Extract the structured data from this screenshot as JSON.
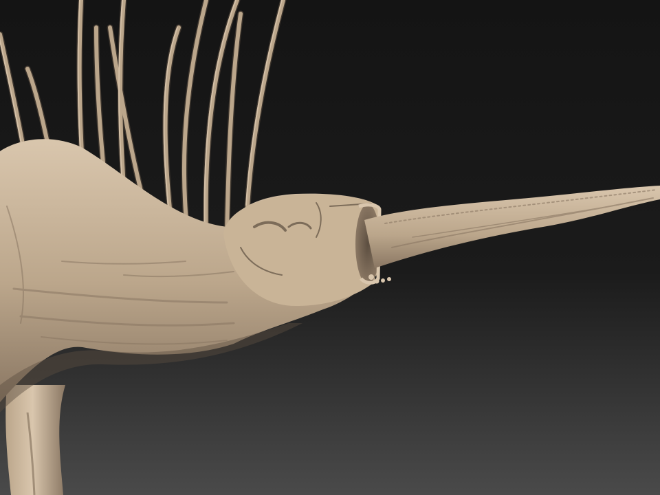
{
  "scene": {
    "subject": "sculpted-creature-render",
    "colors": {
      "background_top": "#141414",
      "background_mid": "#1b1b1b",
      "background_bottom": "#4a4a4a",
      "material_light": "#d9c6ad",
      "material_mid": "#bba68b",
      "material_shadow": "#8a7763",
      "material_dark": "#5c4e40"
    },
    "parts": [
      "body",
      "neck",
      "head",
      "mouth",
      "proboscis",
      "front-leg",
      "spines"
    ]
  }
}
